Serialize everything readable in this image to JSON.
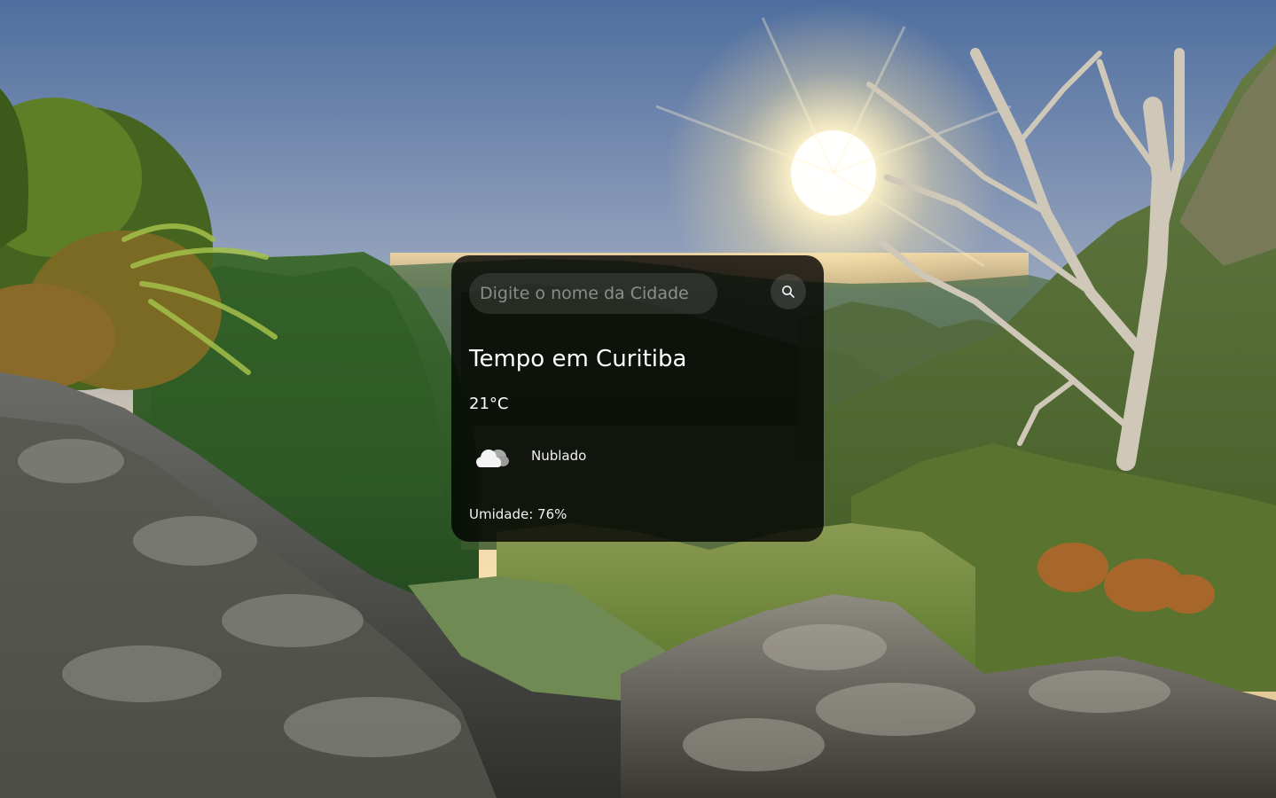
{
  "background": {
    "description_icon": "mountain-sunset-landscape",
    "sky_top": "#5d7aa6",
    "sky_horizon": "#f3d9a6",
    "sun_color": "#fff6d6"
  },
  "search": {
    "placeholder": "Digite o nome da Cidade",
    "value": "",
    "button_icon": "search-icon"
  },
  "weather": {
    "title": "Tempo em Curitiba",
    "temperature": "21°C",
    "condition_icon": "cloud-icon",
    "condition": "Nublado",
    "humidity_label": "Umidade: ",
    "humidity_value": "76%"
  },
  "colors": {
    "card_background": "rgba(0,0,0,0.80)",
    "text": "#ffffff"
  }
}
